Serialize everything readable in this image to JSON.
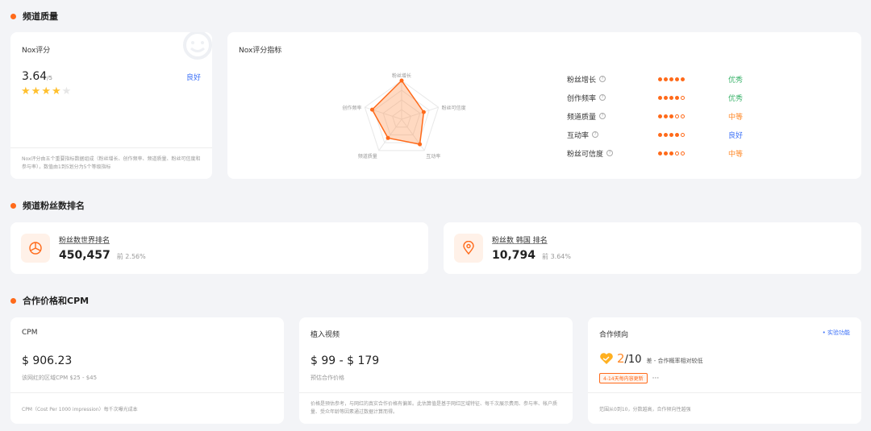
{
  "sections": {
    "quality": "频道质量",
    "ranking": "频道粉丝数排名",
    "pricing": "合作价格和CPM"
  },
  "nox_score": {
    "title": "Nox评分",
    "score": "3.64",
    "out_of": "/5",
    "grade": "良好",
    "grade_color": "#3a6ff7",
    "stars_filled": 4,
    "stars_total": 5,
    "description": "Nox评分由五个重要指标数据组成（粉丝增长、创作频率、频道质量、粉丝可信度和参与率），数值由1到5划分为5个等级指标"
  },
  "nox_metrics": {
    "title": "Nox评分指标",
    "radar_labels": [
      "粉丝增长",
      "粉丝可信度",
      "互动率",
      "频道质量",
      "创作频率"
    ],
    "radar_values": [
      5,
      3,
      4,
      3,
      4
    ],
    "rows": [
      {
        "name": "粉丝增长",
        "filled": 5,
        "grade": "优秀",
        "color": "#3bb36b"
      },
      {
        "name": "创作频率",
        "filled": 4,
        "grade": "优秀",
        "color": "#3bb36b"
      },
      {
        "name": "频道质量",
        "filled": 3,
        "grade": "中等",
        "color": "#ff8a2a"
      },
      {
        "name": "互动率",
        "filled": 4,
        "grade": "良好",
        "color": "#3a6ff7"
      },
      {
        "name": "粉丝可信度",
        "filled": 3,
        "grade": "中等",
        "color": "#ff8a2a"
      }
    ],
    "help_glyph": "?"
  },
  "world_rank": {
    "label": "粉丝数世界排名",
    "value": "450,457",
    "percent": "前 2.56%"
  },
  "country_rank": {
    "label": "粉丝数 韩国 排名",
    "value": "10,794",
    "percent": "前 3.64%"
  },
  "cpm": {
    "title": "CPM",
    "value": "$ 906.23",
    "sub": "该网红的区域CPM $25 - $45",
    "footer": "CPM（Cost Per 1000 impression）每千次曝光成本"
  },
  "embedded_video": {
    "title": "植入视频",
    "value": "$ 99 - $ 179",
    "sub": "预估合作价格",
    "footer": "价格是预估参考，与网红的真实合作价格有偏差。此估算值是基于网红区域特征、每千次展示费用、参与率、帐户质量、受众年龄等因素通过数据计算而得。"
  },
  "cooperation": {
    "title": "合作倾向",
    "lab": "实验功能",
    "score": "2",
    "out_of": "/10",
    "level": "差 - 合作概率相对较低",
    "update_tag": "4-14天每内容更新",
    "more": "···",
    "footer": "范围从0到10，分数越高，合作倾向性越强"
  }
}
